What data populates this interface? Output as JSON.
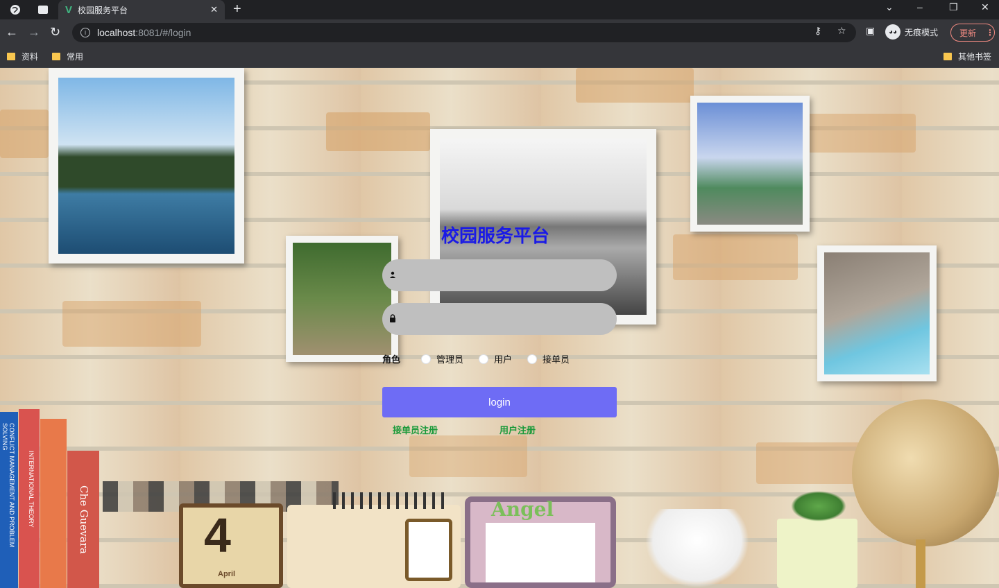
{
  "browser": {
    "tab_title": "校园服务平台",
    "tab_favicon": "V",
    "url_host": "localhost",
    "url_path": ":8081/#/login",
    "incognito_label": "无痕模式",
    "update_label": "更新",
    "bookmarks": [
      "资料",
      "常用"
    ],
    "other_bookmarks": "其他书签"
  },
  "login": {
    "title": "校园服务平台",
    "username_placeholder": "",
    "password_placeholder": "",
    "role_label": "角色",
    "roles": [
      "管理员",
      "用户",
      "接单员"
    ],
    "login_button": "login",
    "register_courier": "接单员注册",
    "register_user": "用户注册"
  },
  "colors": {
    "title": "#1a1ae6",
    "login_button": "#6e6cf5",
    "register_links": "#1a9a3a",
    "input_bg": "#bfbfbf"
  },
  "scene": {
    "calendar_number": "4",
    "calendar_month": "April",
    "angel_text": "Angel",
    "book_titles": [
      "CONFLICT MANAGEMENT AND PROBLEM SOLVING",
      "INTERNATIONAL THEORY",
      "Che Guevara"
    ]
  }
}
